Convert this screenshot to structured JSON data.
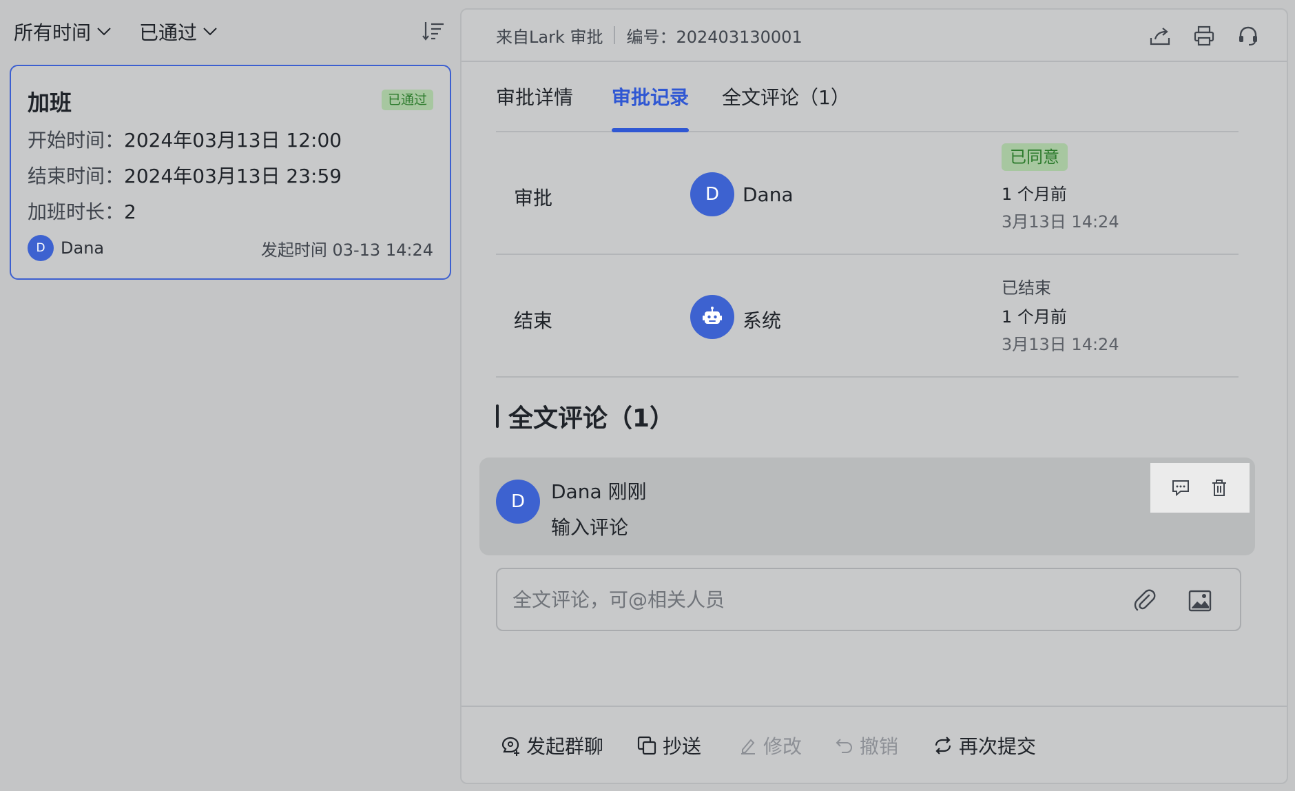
{
  "filters": {
    "time_label": "所有时间",
    "status_label": "已通过"
  },
  "card": {
    "title": "加班",
    "badge": "已通过",
    "start_key": "开始时间：",
    "start_val": "2024年03月13日 12:00",
    "end_key": "结束时间：",
    "end_val": "2024年03月13日 23:59",
    "dur_key": "加班时长：",
    "dur_val": "2",
    "avatar_letter": "D",
    "user": "Dana",
    "submit_time": "发起时间 03-13 14:24"
  },
  "header": {
    "source": "来自Lark 审批",
    "serial": "编号：202403130001",
    "icons": [
      "share-icon",
      "print-icon",
      "support-icon"
    ]
  },
  "tabs": [
    {
      "label": "审批详情"
    },
    {
      "label": "审批记录"
    },
    {
      "label": "全文评论（1）"
    }
  ],
  "active_tab": "审批记录",
  "records": [
    {
      "label": "审批",
      "avatar": "D",
      "name": "Dana",
      "status": "已同意",
      "relative": "1 个月前",
      "time": "3月13日 14:24"
    },
    {
      "label": "结束",
      "avatar_icon": "robot-icon",
      "name": "系统",
      "status": "已结束",
      "relative": "1 个月前",
      "time": "3月13日 14:24"
    }
  ],
  "comments_title": "全文评论（1）",
  "comment": {
    "avatar": "D",
    "author_line": "Dana 刚刚",
    "text": "输入评论"
  },
  "comment_input": {
    "placeholder": "全文评论，可@相关人员",
    "value": ""
  },
  "actions": {
    "group_chat": "发起群聊",
    "cc": "抄送",
    "modify": "修改",
    "withdraw": "撤销",
    "resubmit": "再次提交"
  },
  "colors": {
    "accent": "#2f57d3",
    "avatar": "#3d62d0",
    "success_bg": "#a7c7a0",
    "success_text": "#2b7a2b"
  }
}
